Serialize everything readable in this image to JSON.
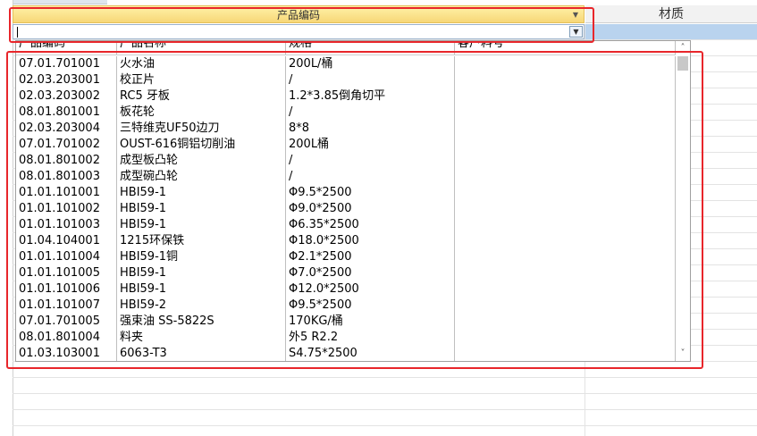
{
  "header": {
    "active_column": "产品编码",
    "next_column": "材质"
  },
  "filter": {
    "value": "",
    "dropdown_icon": "chevron-down-icon"
  },
  "list": {
    "columns": [
      "产品编码",
      "产品名称",
      "规格",
      "客户料号"
    ],
    "rows": [
      {
        "code": "07.01.701001",
        "name": "火水油",
        "spec": "200L/桶",
        "cust": ""
      },
      {
        "code": "02.03.203001",
        "name": "校正片",
        "spec": "/",
        "cust": ""
      },
      {
        "code": "02.03.203002",
        "name": "RC5 牙板",
        "spec": "1.2*3.85倒角切平",
        "cust": ""
      },
      {
        "code": "08.01.801001",
        "name": "板花轮",
        "spec": "/",
        "cust": ""
      },
      {
        "code": "02.03.203004",
        "name": "三特维克UF50边刀",
        "spec": "8*8",
        "cust": ""
      },
      {
        "code": "07.01.701002",
        "name": "OUST-616铜铝切削油",
        "spec": "200L桶",
        "cust": ""
      },
      {
        "code": "08.01.801002",
        "name": "成型板凸轮",
        "spec": "/",
        "cust": ""
      },
      {
        "code": "08.01.801003",
        "name": "成型碗凸轮",
        "spec": "/",
        "cust": ""
      },
      {
        "code": "01.01.101001",
        "name": "HBI59-1",
        "spec": "Φ9.5*2500",
        "cust": ""
      },
      {
        "code": "01.01.101002",
        "name": "HBI59-1",
        "spec": "Φ9.0*2500",
        "cust": ""
      },
      {
        "code": "01.01.101003",
        "name": "HBI59-1",
        "spec": "Φ6.35*2500",
        "cust": ""
      },
      {
        "code": "01.04.104001",
        "name": "1215环保铁",
        "spec": "Φ18.0*2500",
        "cust": ""
      },
      {
        "code": "01.01.101004",
        "name": "HBI59-1铜",
        "spec": "Φ2.1*2500",
        "cust": ""
      },
      {
        "code": "01.01.101005",
        "name": "HBI59-1",
        "spec": "Φ7.0*2500",
        "cust": ""
      },
      {
        "code": "01.01.101006",
        "name": "HBI59-1",
        "spec": "Φ12.0*2500",
        "cust": ""
      },
      {
        "code": "01.01.101007",
        "name": "HBI59-2",
        "spec": "Φ9.5*2500",
        "cust": ""
      },
      {
        "code": "07.01.701005",
        "name": "强束油 SS-5822S",
        "spec": "170KG/桶",
        "cust": ""
      },
      {
        "code": "08.01.801004",
        "name": "料夹",
        "spec": "外5 R2.2",
        "cust": ""
      },
      {
        "code": "01.03.103001",
        "name": "6063-T3",
        "spec": "S4.75*2500",
        "cust": ""
      }
    ]
  },
  "colors": {
    "highlight": "#e8262b",
    "active_header": "#f7d777",
    "selection": "#b9d3ee"
  }
}
